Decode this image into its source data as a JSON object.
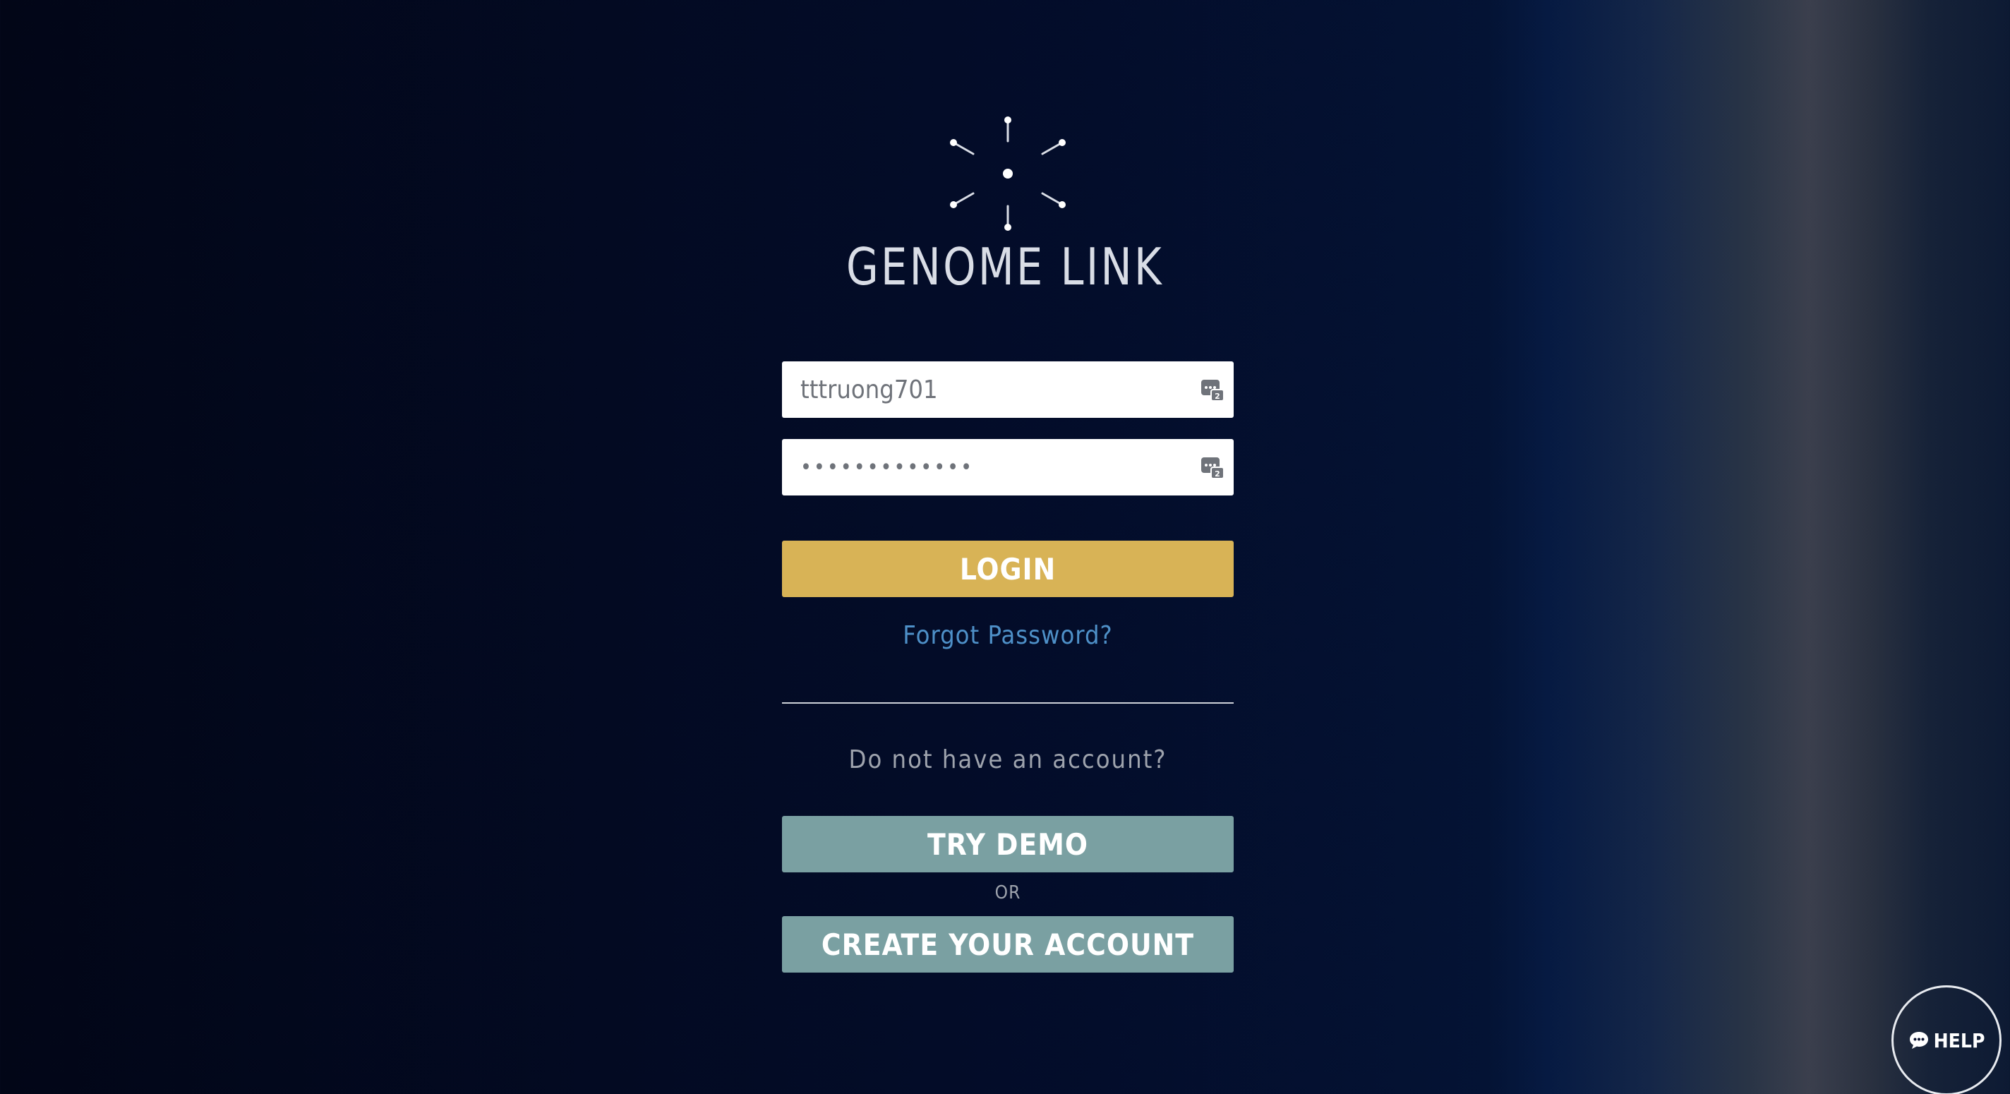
{
  "brand": {
    "logo_icon": "genome-link-logo-icon",
    "name": "GENOME LINK"
  },
  "login_form": {
    "username_value": "tttruong701",
    "password_value": "tttruong70123",
    "field_icon": "password-manager-icon",
    "login_label": "LOGIN",
    "forgot_label": "Forgot Password?"
  },
  "signup": {
    "prompt": "Do not have an account?",
    "try_demo_label": "TRY DEMO",
    "or_label": "OR",
    "create_label": "CREATE YOUR ACCOUNT"
  },
  "help": {
    "icon": "chat-bubble-icon",
    "label": "HELP"
  },
  "colors": {
    "login_button": "#d8b356",
    "secondary_button": "#7aa0a2",
    "link": "#4e90c8",
    "background": "#020617"
  }
}
